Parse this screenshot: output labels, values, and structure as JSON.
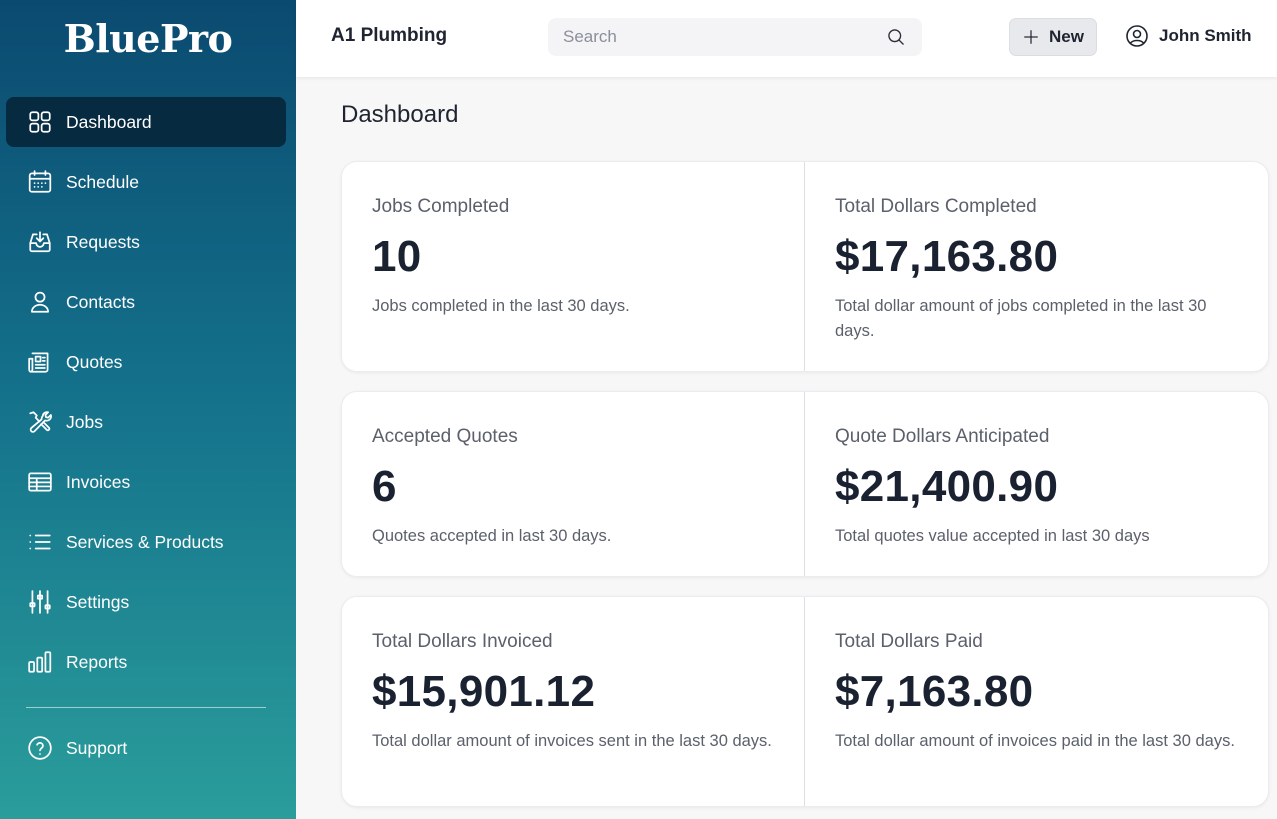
{
  "app": {
    "logo": "BluePro"
  },
  "sidebar": {
    "items": [
      {
        "label": "Dashboard",
        "icon": "grid-icon",
        "active": true
      },
      {
        "label": "Schedule",
        "icon": "calendar-icon"
      },
      {
        "label": "Requests",
        "icon": "inbox-download-icon"
      },
      {
        "label": "Contacts",
        "icon": "user-icon"
      },
      {
        "label": "Quotes",
        "icon": "newspaper-icon"
      },
      {
        "label": "Jobs",
        "icon": "tools-icon"
      },
      {
        "label": "Invoices",
        "icon": "table-icon"
      },
      {
        "label": "Services & Products",
        "icon": "list-icon"
      },
      {
        "label": "Settings",
        "icon": "sliders-icon"
      },
      {
        "label": "Reports",
        "icon": "bar-chart-icon"
      }
    ],
    "support": {
      "label": "Support",
      "icon": "help-circle-icon"
    }
  },
  "header": {
    "company": "A1 Plumbing",
    "search_placeholder": "Search",
    "new_label": "New",
    "user_name": "John Smith"
  },
  "main": {
    "title": "Dashboard",
    "stats": [
      {
        "left": {
          "label": "Jobs Completed",
          "value": "10",
          "desc": "Jobs completed in the last 30 days."
        },
        "right": {
          "label": "Total Dollars Completed",
          "value": "$17,163.80",
          "desc": "Total dollar amount of jobs completed in the last 30 days."
        }
      },
      {
        "left": {
          "label": "Accepted Quotes",
          "value": "6",
          "desc": "Quotes accepted in last 30 days."
        },
        "right": {
          "label": "Quote Dollars Anticipated",
          "value": "$21,400.90",
          "desc": "Total quotes value accepted in last 30 days"
        }
      },
      {
        "left": {
          "label": "Total Dollars Invoiced",
          "value": "$15,901.12",
          "desc": "Total dollar amount of invoices sent in the last 30 days."
        },
        "right": {
          "label": "Total Dollars Paid",
          "value": "$7,163.80",
          "desc": "Total dollar amount of invoices paid in the last 30 days."
        }
      }
    ]
  },
  "colors": {
    "sidebar_top": "#0b4a70",
    "sidebar_bottom": "#2a9d9b",
    "active_item": "#062a40"
  }
}
